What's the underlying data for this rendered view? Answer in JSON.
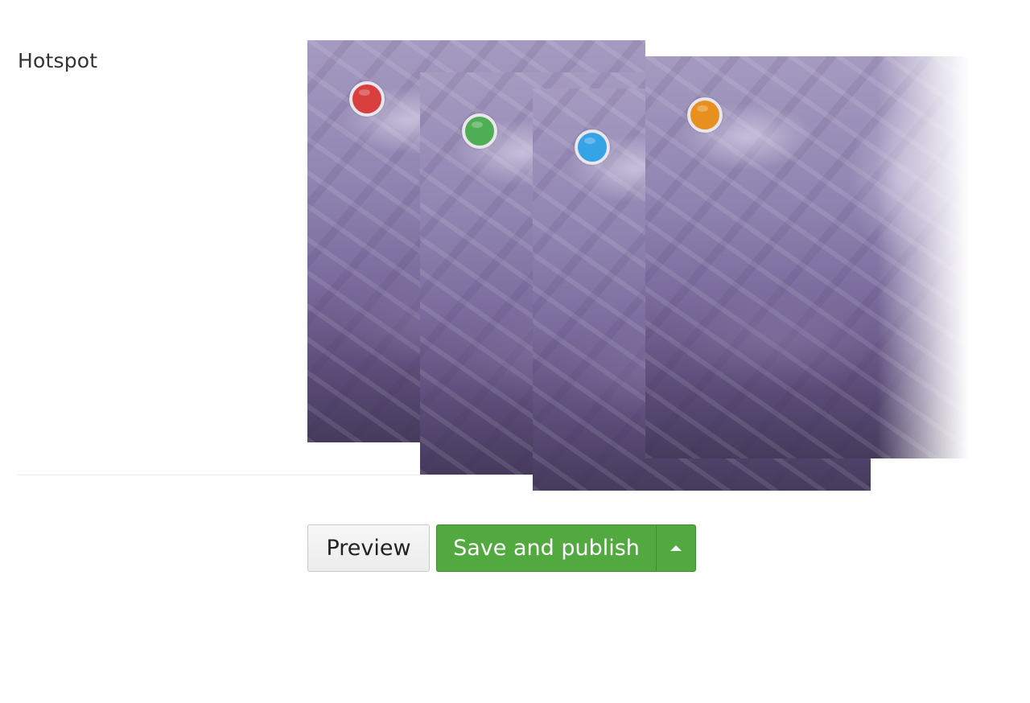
{
  "field": {
    "label": "Hotspot"
  },
  "hotspots": [
    {
      "name": "red",
      "color": "#d93f3f"
    },
    {
      "name": "green",
      "color": "#4fae55"
    },
    {
      "name": "blue",
      "color": "#36a3e6"
    },
    {
      "name": "orange",
      "color": "#e8901f"
    }
  ],
  "actions": {
    "preview_label": "Preview",
    "save_label": "Save and publish",
    "more_icon": "caret-up-icon",
    "save_color": "#52a93f"
  }
}
